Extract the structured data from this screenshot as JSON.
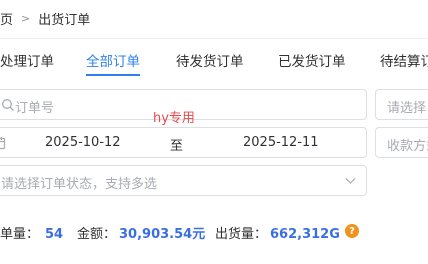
{
  "breadcrumb": {
    "home": "页",
    "current": "出货订单"
  },
  "tabs": [
    "处理订单",
    "全部订单",
    "待发货订单",
    "已发货订单",
    "待结算订"
  ],
  "search": {
    "order_no_placeholder": "订单号",
    "right_placeholder": "请选择"
  },
  "date_range": {
    "start": "2025-10-12",
    "separator": "至",
    "end": "2025-12-11"
  },
  "payment": {
    "placeholder": "收款方式"
  },
  "status_select": {
    "placeholder": "请选择订单状态，支持多选"
  },
  "watermark": "hy专用",
  "summary": {
    "count_label": "单量：",
    "count": "54",
    "amount_label": "金额：",
    "amount": "30,903.54元",
    "qty_label": "出货量：",
    "qty": "662,312G",
    "help_icon_text": "?"
  },
  "colors": {
    "accent": "#2f80ed",
    "number": "#3b6fe0",
    "help": "#f0921b",
    "watermark": "#e64a4a"
  }
}
